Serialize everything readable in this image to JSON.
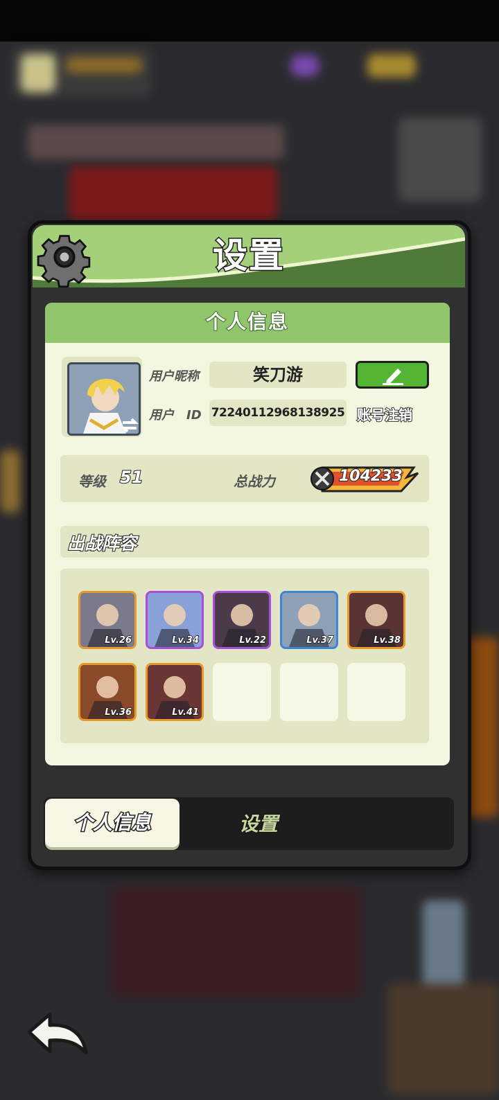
{
  "dialog": {
    "title": "设置",
    "section_title": "个人信息"
  },
  "profile": {
    "nickname_label": "用户昵称",
    "nickname": "笑刀游",
    "userid_label": "用户　ID",
    "userid": "72240112968138925",
    "cancel_account_label": "账号注销",
    "level_label": "等级",
    "level": "51",
    "power_label": "总战力",
    "power": "104233"
  },
  "lineup": {
    "title": "出战阵容",
    "heroes": [
      {
        "level": "Lv.26",
        "frame": "#e89a2a",
        "bg": "#7a7a8a"
      },
      {
        "level": "Lv.34",
        "frame": "#a84fd9",
        "bg": "#8aa0d8"
      },
      {
        "level": "Lv.22",
        "frame": "#a84fd9",
        "bg": "#4b3a4a"
      },
      {
        "level": "Lv.37",
        "frame": "#3d86d6",
        "bg": "#8ea0b6"
      },
      {
        "level": "Lv.38",
        "frame": "#e89a2a",
        "bg": "#5a3333"
      },
      {
        "level": "Lv.36",
        "frame": "#e89a2a",
        "bg": "#8a4a2a"
      },
      {
        "level": "Lv.41",
        "frame": "#e89a2a",
        "bg": "#6a3535"
      }
    ],
    "empty_slots": 3
  },
  "tabs": {
    "personal": "个人信息",
    "settings": "设置"
  },
  "icons": {
    "gear": "gear-icon",
    "edit": "edit-pencil-icon",
    "power": "crossed-swords-icon",
    "back": "back-arrow-icon",
    "swap": "swap-arrows-icon"
  },
  "colors": {
    "accent_green": "#90c56b",
    "button_green": "#54b535",
    "panel_bg": "#f4f7df",
    "field_bg": "#e2e6c4"
  }
}
